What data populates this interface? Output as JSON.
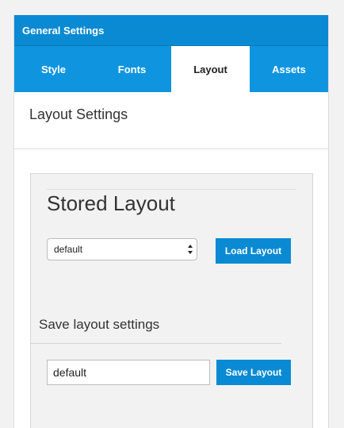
{
  "panel": {
    "title": "General Settings"
  },
  "tabs": [
    {
      "label": "Style",
      "active": false
    },
    {
      "label": "Fonts",
      "active": false
    },
    {
      "label": "Layout",
      "active": true
    },
    {
      "label": "Assets",
      "active": false
    }
  ],
  "section": {
    "title": "Layout Settings"
  },
  "stored_layout": {
    "title": "Stored Layout",
    "select_value": "default",
    "load_button": "Load Layout"
  },
  "save_layout": {
    "title": "Save layout settings",
    "input_value": "default",
    "save_button": "Save Layout"
  },
  "colors": {
    "header": "#0a8ad3",
    "tabs_bar": "#0f95e0",
    "button": "#0a8ad3",
    "well": "#f2f2f2"
  }
}
